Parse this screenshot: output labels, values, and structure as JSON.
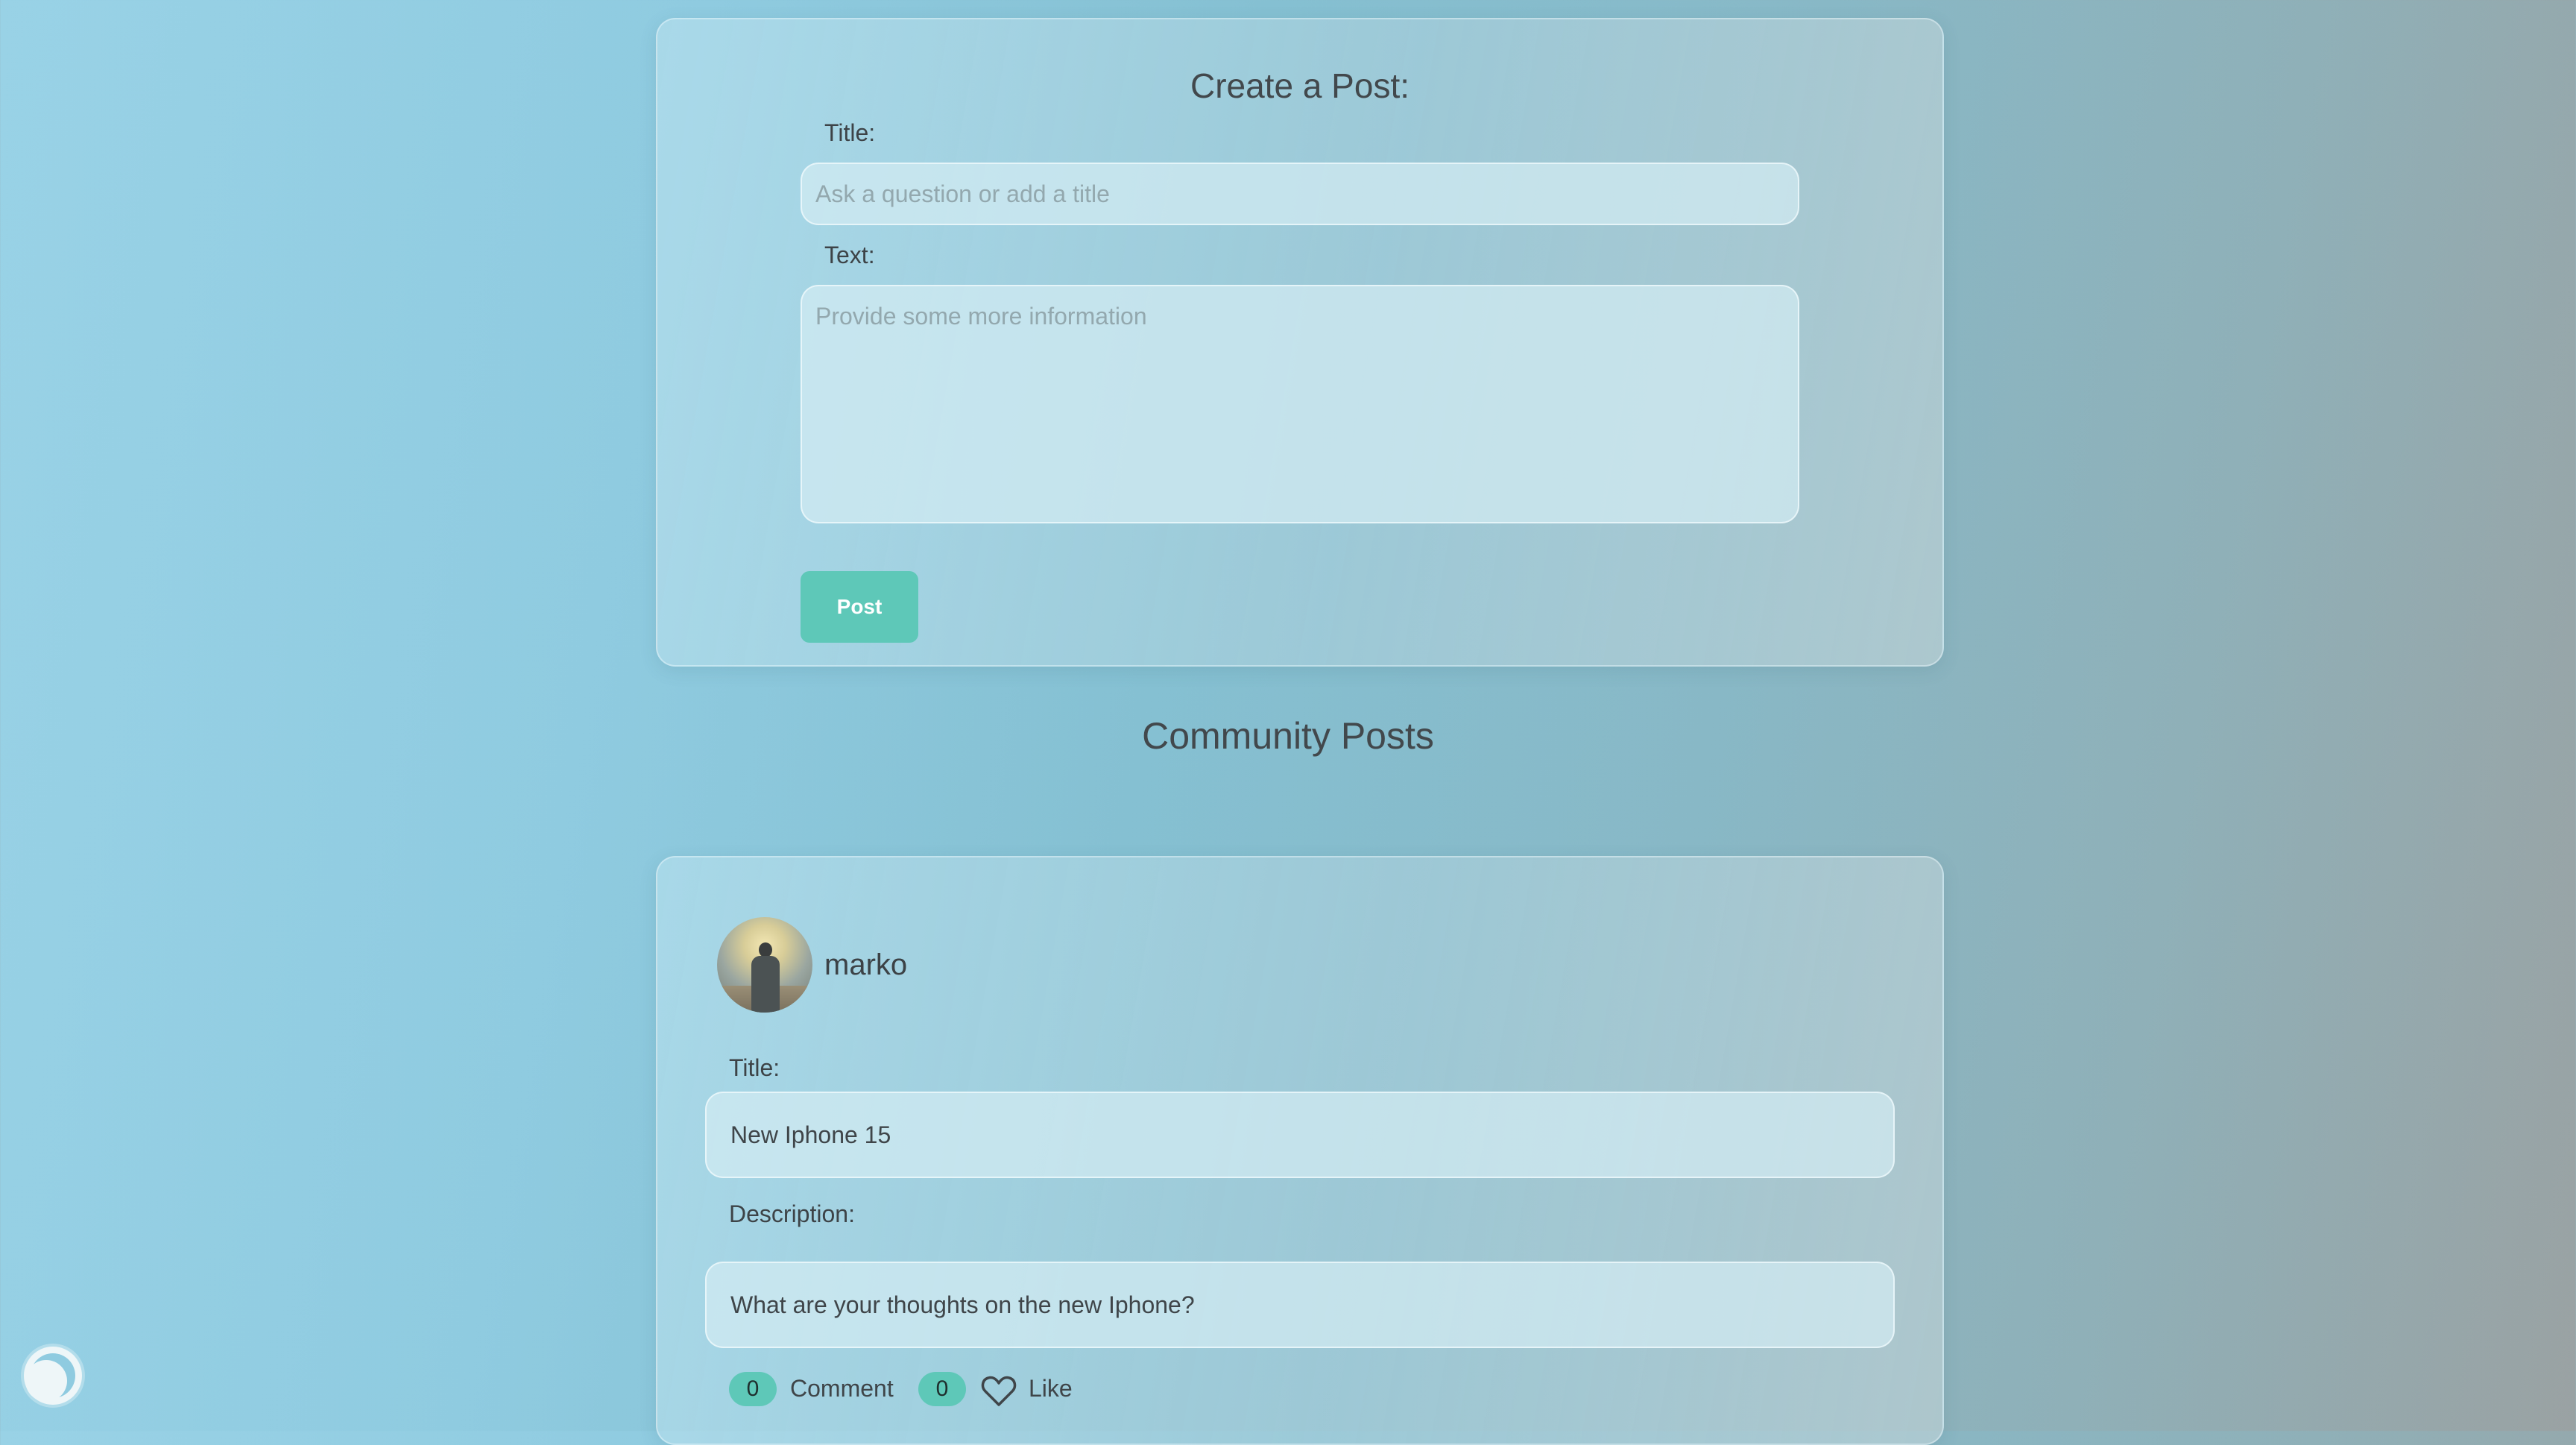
{
  "create_post": {
    "heading": "Create a Post:",
    "title_label": "Title:",
    "title_placeholder": "Ask a question or add a title",
    "title_value": "",
    "text_label": "Text:",
    "text_placeholder": "Provide some more information",
    "text_value": "",
    "post_button": "Post"
  },
  "community": {
    "heading": "Community Posts",
    "posts": [
      {
        "username": "marko",
        "avatar_icon": "user-avatar-photo",
        "title_label": "Title:",
        "title": "New Iphone 15",
        "description_label": "Description:",
        "description": "What are your thoughts on the new Iphone?",
        "comment_count": "0",
        "comment_label": "Comment",
        "like_count": "0",
        "like_icon": "heart-icon",
        "like_label": "Like"
      }
    ]
  },
  "theme_toggle_icon": "moon-icon",
  "colors": {
    "accent": "#5ec8b8"
  }
}
